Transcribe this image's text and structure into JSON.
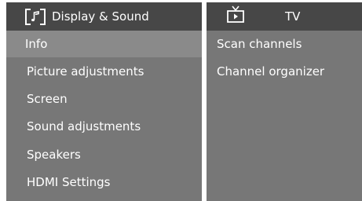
{
  "display_sound": {
    "title": "Display & Sound",
    "icon": "music-note-icon",
    "items": [
      {
        "label": "Info"
      },
      {
        "label": "Picture adjustments"
      },
      {
        "label": "Screen"
      },
      {
        "label": "Sound adjustments"
      },
      {
        "label": "Speakers"
      },
      {
        "label": "HDMI Settings"
      }
    ]
  },
  "tv": {
    "title": "TV",
    "icon": "tv-play-icon",
    "items": [
      {
        "label": "Scan channels"
      },
      {
        "label": "Channel organizer"
      }
    ]
  },
  "colors": {
    "panel": "#777777",
    "header": "#474747",
    "highlight": "#8a8a8a",
    "text": "#ffffff"
  }
}
